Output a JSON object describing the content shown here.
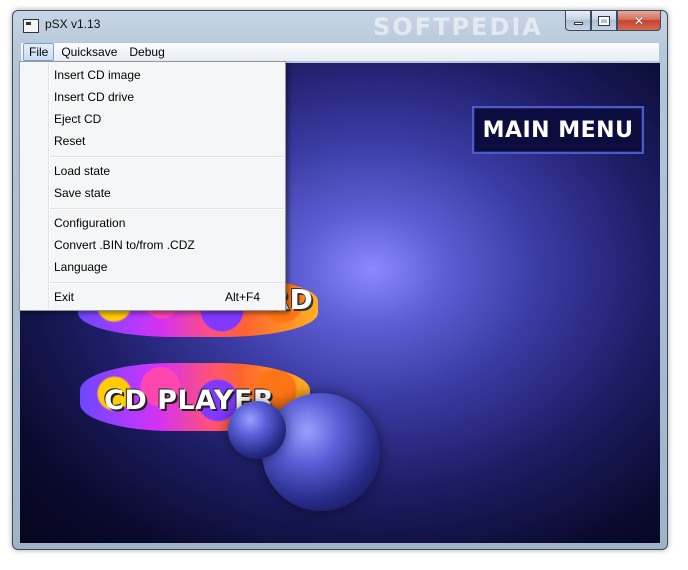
{
  "window": {
    "title": "pSX v1.13",
    "watermark": "SOFTPEDIA"
  },
  "menubar": {
    "items": [
      {
        "label": "File",
        "active": true
      },
      {
        "label": "Quicksave",
        "active": false
      },
      {
        "label": "Debug",
        "active": false
      }
    ]
  },
  "file_menu": {
    "items": [
      {
        "label": "Insert CD image"
      },
      {
        "label": "Insert CD drive"
      },
      {
        "label": "Eject CD"
      },
      {
        "label": "Reset"
      },
      {
        "label": "Load state"
      },
      {
        "label": "Save state"
      },
      {
        "label": "Configuration"
      },
      {
        "label": "Convert .BIN to/from .CDZ"
      },
      {
        "label": "Language"
      },
      {
        "label": "Exit",
        "shortcut": "Alt+F4"
      }
    ]
  },
  "screen": {
    "main_menu_label": "MAIN MENU",
    "memory_card_label_fragment": "RD",
    "cd_player_label": "CD PLAYER"
  },
  "colors": {
    "background_center": "#8d89ff",
    "background_edge": "#05051d",
    "main_menu_border": "#4a5bd0",
    "close_button": "#c4432e"
  }
}
